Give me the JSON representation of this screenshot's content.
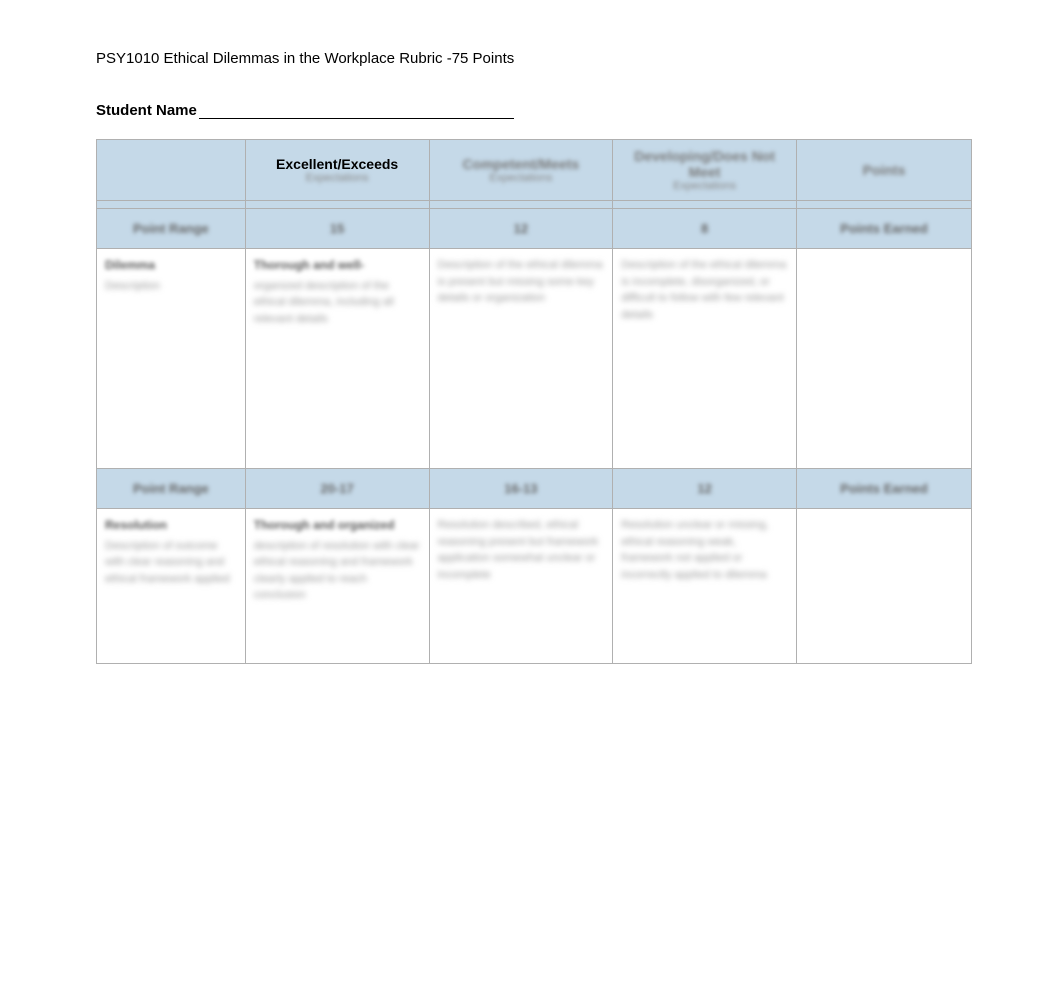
{
  "title": "PSY1010 Ethical Dilemmas in the Workplace Rubric -75 Points",
  "studentNameLabel": "Student Name",
  "headers": {
    "criteria": "",
    "excellent": "Excellent/Exceeds",
    "excellentSub": "Expectations",
    "competent": "Competent/Meets",
    "competentSub": "Expectations",
    "developing": "Developing/Does Not Meet",
    "developingSub": "Expectations",
    "points": "Points"
  },
  "row1": {
    "pointsLabel": "Point Range",
    "excellent": "15",
    "competent": "12",
    "developing": "8",
    "points": "Points Earned"
  },
  "content1": {
    "criteriaHead": "Dilemma",
    "criteriaBody": "Description",
    "excellentHead": "Thorough and well-",
    "excellentBody": "organized description of the ethical dilemma, including all relevant details",
    "competentHead": "",
    "competentBody": "Description of the ethical dilemma is present but missing some key details or organization",
    "developingHead": "",
    "developingBody": "Description of the ethical dilemma is incomplete, disorganized, or difficult to follow with few relevant details",
    "pointsBody": ""
  },
  "row2": {
    "pointsLabel": "Point Range",
    "excellent": "20-17",
    "competent": "16-13",
    "developing": "12",
    "points": "Points Earned"
  },
  "content2": {
    "criteriaHead": "Resolution",
    "criteriaBody": "Description of outcome with clear reasoning and ethical framework applied",
    "excellentHead": "Thorough and organized",
    "excellentBody": "description of resolution with clear ethical reasoning and framework clearly applied to reach conclusion",
    "competentHead": "",
    "competentBody": "Resolution described, ethical reasoning present but framework application somewhat unclear or incomplete",
    "developingHead": "",
    "developingBody": "Resolution unclear or missing, ethical reasoning weak, framework not applied or incorrectly applied to dilemma",
    "pointsBody": ""
  }
}
